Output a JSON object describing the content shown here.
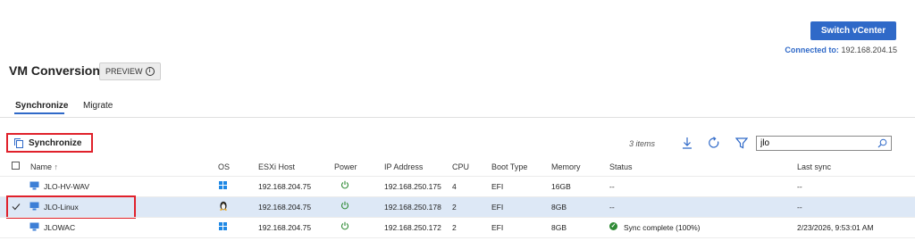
{
  "header": {
    "switch_label": "Switch vCenter",
    "connected_label": "Connected to:",
    "connected_value": "192.168.204.15"
  },
  "page": {
    "title": "VM Conversion",
    "preview_badge": "PREVIEW"
  },
  "tabs": [
    {
      "label": "Synchronize"
    },
    {
      "label": "Migrate"
    }
  ],
  "toolbar": {
    "sync_label": "Synchronize",
    "items_count": "3 items",
    "search_value": "jlo"
  },
  "table": {
    "columns": {
      "name": "Name",
      "os": "OS",
      "host": "ESXi Host",
      "power": "Power",
      "ip": "IP Address",
      "cpu": "CPU",
      "boot": "Boot Type",
      "memory": "Memory",
      "status": "Status",
      "last_sync": "Last sync"
    },
    "rows": [
      {
        "name": "JLO-HV-WAV",
        "os": "windows",
        "host": "192.168.204.75",
        "ip": "192.168.250.175",
        "cpu": "4",
        "boot": "EFI",
        "memory": "16GB",
        "status": "--",
        "last_sync": "--",
        "selected": false
      },
      {
        "name": "JLO-Linux",
        "os": "linux",
        "host": "192.168.204.75",
        "ip": "192.168.250.178",
        "cpu": "2",
        "boot": "EFI",
        "memory": "8GB",
        "status": "--",
        "last_sync": "--",
        "selected": true
      },
      {
        "name": "JLOWAC",
        "os": "windows",
        "host": "192.168.204.75",
        "ip": "192.168.250.172",
        "cpu": "2",
        "boot": "EFI",
        "memory": "8GB",
        "status": "Sync complete (100%)",
        "last_sync": "2/23/2026, 9:53:01 AM",
        "selected": false
      }
    ]
  },
  "colors": {
    "accent": "#2f69c8",
    "highlight": "#e0212b",
    "selected_row": "#dde8f6",
    "success": "#2e8a34"
  }
}
